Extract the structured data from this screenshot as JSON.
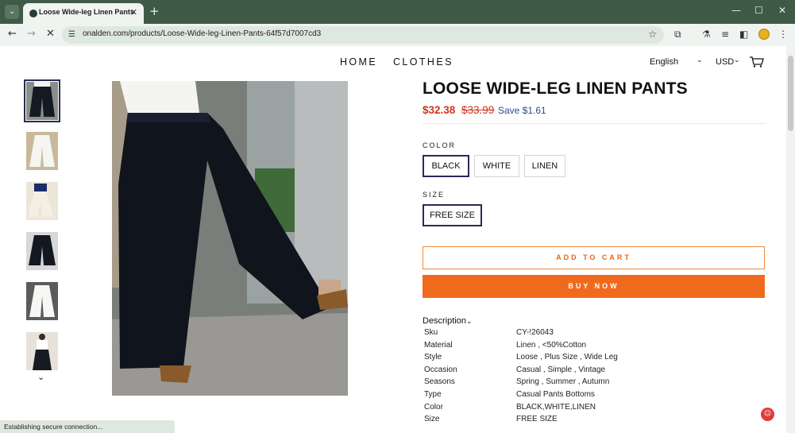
{
  "browser": {
    "tab_title": "Loose Wide-leg Linen Pants",
    "url": "onalden.com/products/Loose-Wide-leg-Linen-Pants-64f57d7007cd3",
    "status": "Establishing secure connection..."
  },
  "header": {
    "nav": [
      "HOME",
      "CLOTHES"
    ],
    "language": "English",
    "currency": "USD"
  },
  "product": {
    "title": "LOOSE WIDE-LEG LINEN PANTS",
    "price_sale": "$32.38",
    "price_original": "$33.99",
    "price_save": "Save $1.61",
    "color_label": "COLOR",
    "colors": [
      "BLACK",
      "WHITE",
      "LINEN"
    ],
    "selected_color": "BLACK",
    "size_label": "SIZE",
    "sizes": [
      "FREE SIZE"
    ],
    "selected_size": "FREE SIZE",
    "add_to_cart": "ADD TO CART",
    "buy_now": "BUY NOW",
    "description_label": "Description",
    "specs": [
      {
        "key": "Sku",
        "value": "CY-!26043"
      },
      {
        "key": "Material",
        "value": "Linen , <50%Cotton"
      },
      {
        "key": "Style",
        "value": "Loose , Plus Size , Wide Leg"
      },
      {
        "key": "Occasion",
        "value": "Casual , Simple , Vintage"
      },
      {
        "key": "Seasons",
        "value": "Spring , Summer , Autumn"
      },
      {
        "key": "Type",
        "value": "Casual Pants Bottoms"
      },
      {
        "key": "Color",
        "value": "BLACK,WHITE,LINEN"
      },
      {
        "key": "Size",
        "value": "FREE SIZE"
      }
    ]
  },
  "colors": {
    "chrome": "#3f5a47",
    "accent_orange": "#f06a1e",
    "sale_red": "#d1341e",
    "save_blue": "#2d4b8f",
    "selected_border": "#2a2a55"
  }
}
